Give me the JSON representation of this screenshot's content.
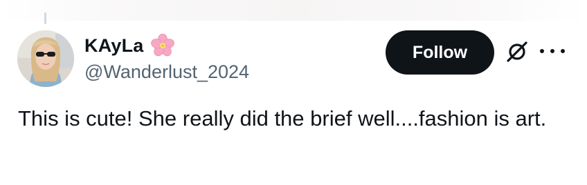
{
  "tweet": {
    "author": {
      "display_name": "KAyLa",
      "badge_icon": "cherry-blossom-icon",
      "handle": "@Wanderlust_2024",
      "avatar_icon": "profile-photo"
    },
    "follow_label": "Follow",
    "text": "This is cute! She really did the brief well....fashion is art."
  },
  "icons": {
    "grok": "grok-slash-circle-icon",
    "more": "more-options-icon"
  },
  "colors": {
    "primary_text": "#0f1419",
    "secondary_text": "#536471",
    "button_bg": "#0f1419",
    "button_text": "#ffffff",
    "blossom": "#f7a8c4"
  }
}
